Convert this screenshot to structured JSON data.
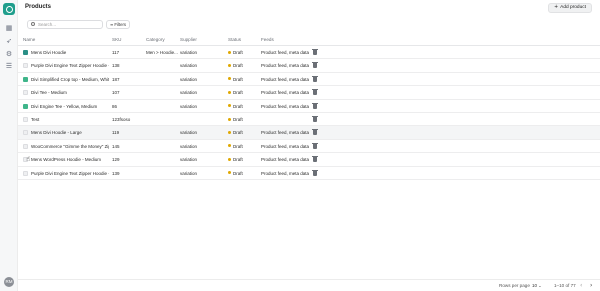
{
  "sidebar": {
    "icons": [
      "logo-icon",
      "grid-icon",
      "rocket-icon",
      "gear-icon",
      "rss-icon"
    ],
    "avatar_initials": "RM"
  },
  "header": {
    "title": "Products",
    "add_button_label": "Add product"
  },
  "toolbar": {
    "search_placeholder": "Search...",
    "filters_label": "Filters"
  },
  "table": {
    "columns": [
      "Name",
      "SKU",
      "Category",
      "Supplier",
      "Status",
      "Feeds"
    ],
    "rows": [
      {
        "name": "Mens Divi Hoodie",
        "sku": "117",
        "category": "Men > Hoodie...",
        "supplier": "variation",
        "status": "Draft",
        "feeds": "Product feed, meta data",
        "thumb": "teal"
      },
      {
        "name": "Purple Divi Engine Text Zipper Hoodie - Large",
        "sku": "138",
        "category": "",
        "supplier": "variation",
        "status": "Draft",
        "feeds": "Product feed, meta data",
        "thumb": "ph"
      },
      {
        "name": "Divi Simplified Crop top - Medium, White",
        "sku": "187",
        "category": "",
        "supplier": "variation",
        "status": "Draft",
        "feeds": "Product feed, meta data",
        "thumb": "green"
      },
      {
        "name": "Divi Tee - Medium",
        "sku": "107",
        "category": "",
        "supplier": "variation",
        "status": "Draft",
        "feeds": "Product feed, meta data",
        "thumb": "ph"
      },
      {
        "name": "Divi Engine Tee - Yellow, Medium",
        "sku": "86",
        "category": "",
        "supplier": "variation",
        "status": "Draft",
        "feeds": "Product feed, meta data",
        "thumb": "green"
      },
      {
        "name": "Test",
        "sku": "123fsoso",
        "category": "",
        "supplier": "",
        "status": "Draft",
        "feeds": "",
        "thumb": "ph"
      },
      {
        "name": "Mens Divi Hoodie - Large",
        "sku": "119",
        "category": "",
        "supplier": "variation",
        "status": "Draft",
        "feeds": "Product feed, meta data",
        "thumb": "ph"
      },
      {
        "name": "WooCommerce \"Gimme the Money\" Zipper H...",
        "sku": "145",
        "category": "",
        "supplier": "variation",
        "status": "Draft",
        "feeds": "Product feed, meta data",
        "thumb": "ph"
      },
      {
        "name": "Mens WordPress Hoodie - Medium",
        "sku": "129",
        "category": "",
        "supplier": "variation",
        "status": "Draft",
        "feeds": "Product feed, meta data",
        "thumb": "ph"
      },
      {
        "name": "Purple Divi Engine Text Zipper Hoodie - Medium",
        "sku": "139",
        "category": "",
        "supplier": "variation",
        "status": "Draft",
        "feeds": "Product feed, meta data",
        "thumb": "ph"
      }
    ]
  },
  "footer": {
    "rows_per_page_label": "Rows per page",
    "rows_per_page_value": "10",
    "range_text": "1–10 of 77"
  },
  "colors": {
    "brand": "#1f9e8c",
    "draft_dot": "#e0a800",
    "thumb_teal": "#2a8f86",
    "thumb_green": "#3fb58a"
  }
}
